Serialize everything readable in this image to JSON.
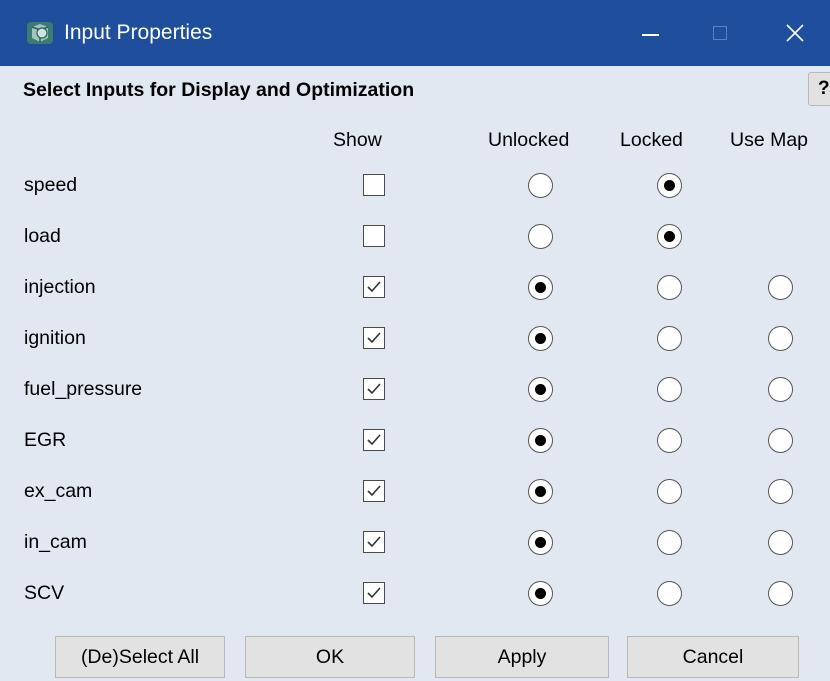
{
  "window": {
    "title": "Input Properties",
    "icon": "app-cube-icon",
    "controls": [
      "minimize-icon",
      "maximize-icon",
      "close-icon"
    ],
    "close_glyph": "✕"
  },
  "header": {
    "label": "Select Inputs for Display and Optimization",
    "help_label": "?"
  },
  "columns": {
    "show": "Show",
    "unlocked": "Unlocked",
    "locked": "Locked",
    "use_map": "Use Map"
  },
  "rows": [
    {
      "name": "speed",
      "show": false,
      "mode": "Locked",
      "use_map_available": false
    },
    {
      "name": "load",
      "show": false,
      "mode": "Locked",
      "use_map_available": false
    },
    {
      "name": "injection",
      "show": true,
      "mode": "Unlocked",
      "use_map_available": true
    },
    {
      "name": "ignition",
      "show": true,
      "mode": "Unlocked",
      "use_map_available": true
    },
    {
      "name": "fuel_pressure",
      "show": true,
      "mode": "Unlocked",
      "use_map_available": true
    },
    {
      "name": "EGR",
      "show": true,
      "mode": "Unlocked",
      "use_map_available": true
    },
    {
      "name": "ex_cam",
      "show": true,
      "mode": "Unlocked",
      "use_map_available": true
    },
    {
      "name": "in_cam",
      "show": true,
      "mode": "Unlocked",
      "use_map_available": true
    },
    {
      "name": "SCV",
      "show": true,
      "mode": "Unlocked",
      "use_map_available": true
    }
  ],
  "buttons": {
    "select_all": "(De)Select All",
    "ok": "OK",
    "apply": "Apply",
    "cancel": "Cancel"
  },
  "colors": {
    "titlebar": "#1f4e9c",
    "dialog_background": "#e1e8f1",
    "button_background": "#e2e2e2"
  }
}
